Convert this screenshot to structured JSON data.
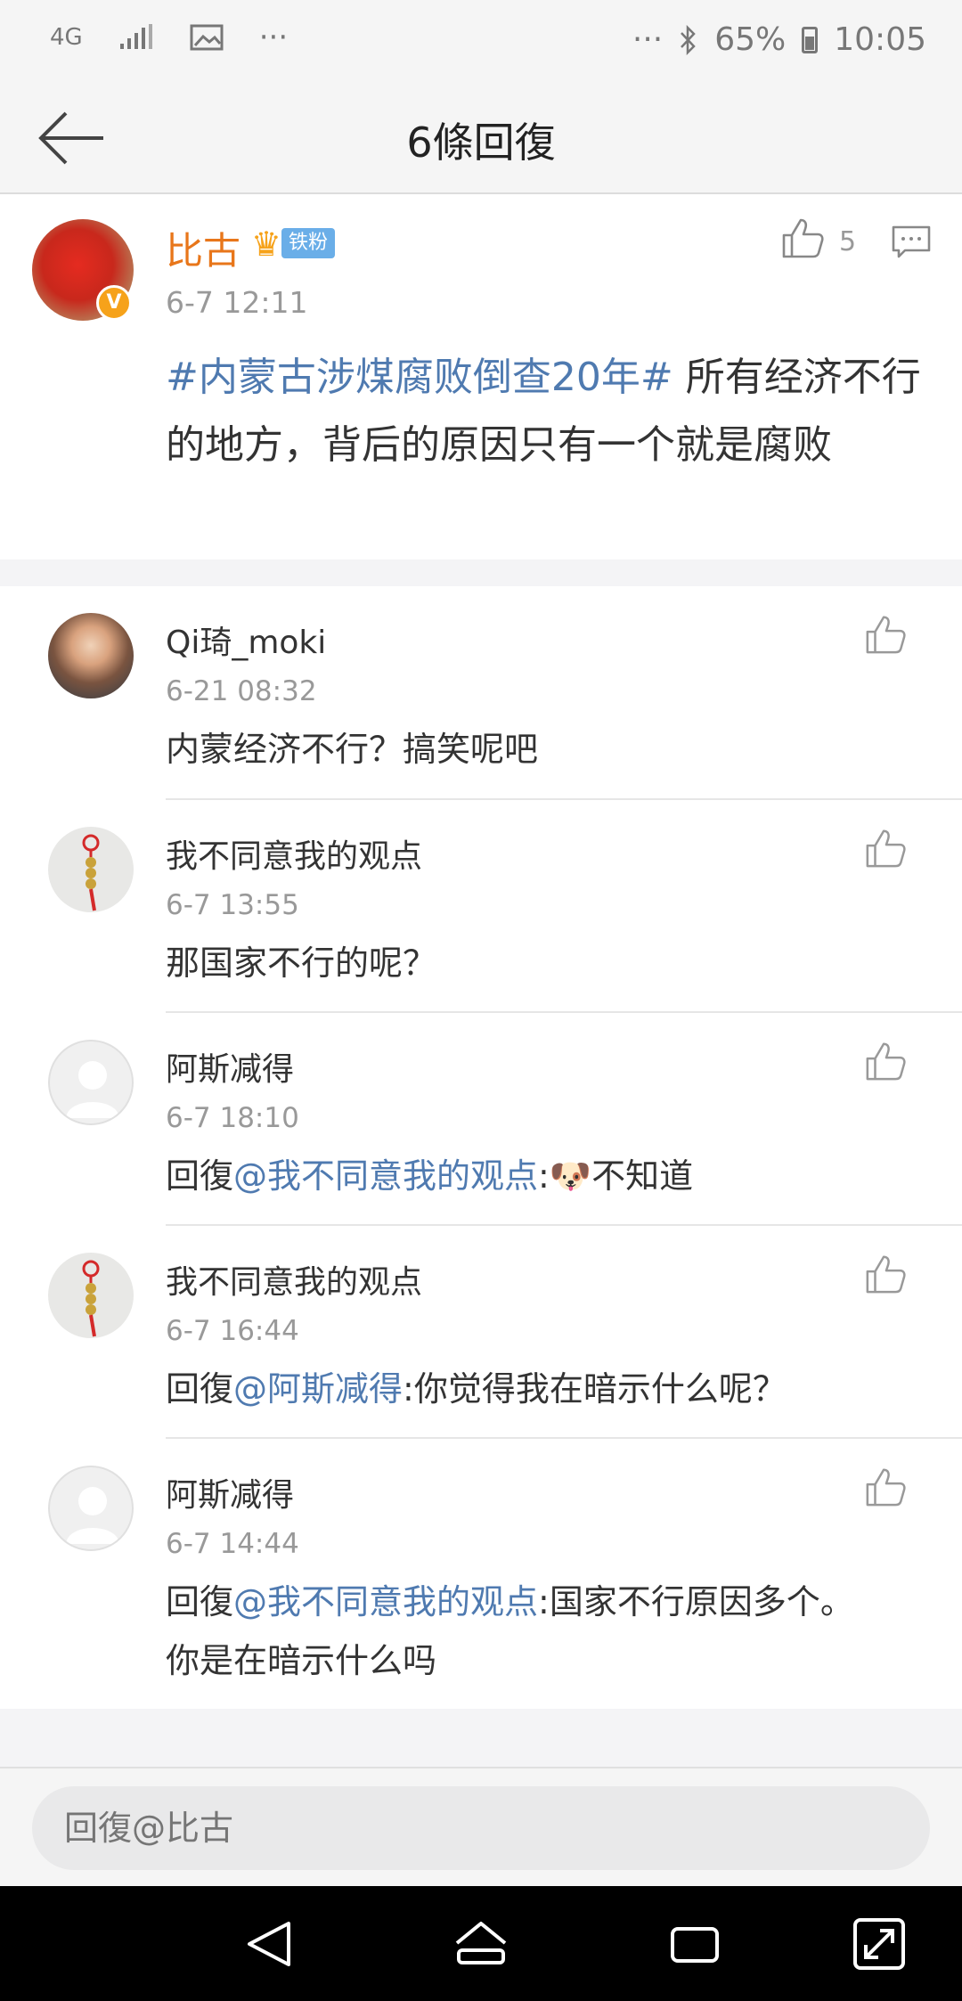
{
  "status_bar": {
    "network": "4G",
    "battery": "65%",
    "time": "10:05",
    "more": "···"
  },
  "header": {
    "title": "6條回復"
  },
  "post": {
    "author": "比古",
    "fan_badge": "铁粉",
    "time": "6-7 12:11",
    "like_count": "5",
    "hashtag": "#内蒙古涉煤腐败倒查20年#",
    "text": " 所有经济不行的地方，背后的原因只有一个就是腐败"
  },
  "replies": [
    {
      "name": "Qi琦_moki",
      "time": "6-21 08:32",
      "prefix": "",
      "mention": "",
      "text": "内蒙经济不行？搞笑呢吧",
      "avatar": "photo"
    },
    {
      "name": "我不同意我的观点",
      "time": "6-7 13:55",
      "prefix": "",
      "mention": "",
      "text": "那国家不行的呢？",
      "avatar": "tassel"
    },
    {
      "name": "阿斯减得",
      "time": "6-7 18:10",
      "prefix": "回復",
      "mention": "@我不同意我的观点",
      "text": ":🐶不知道",
      "avatar": "default"
    },
    {
      "name": "我不同意我的观点",
      "time": "6-7 16:44",
      "prefix": "回復",
      "mention": "@阿斯减得",
      "text": ":你觉得我在暗示什么呢？",
      "avatar": "tassel"
    },
    {
      "name": "阿斯减得",
      "time": "6-7 14:44",
      "prefix": "回復",
      "mention": "@我不同意我的观点",
      "text": ":国家不行原因多个。你是在暗示什么吗",
      "avatar": "default"
    }
  ],
  "input": {
    "placeholder": "回復@比古"
  },
  "colors": {
    "link": "#4f7ab0",
    "author_name": "#e8761a",
    "badge": "#6aaee8"
  }
}
